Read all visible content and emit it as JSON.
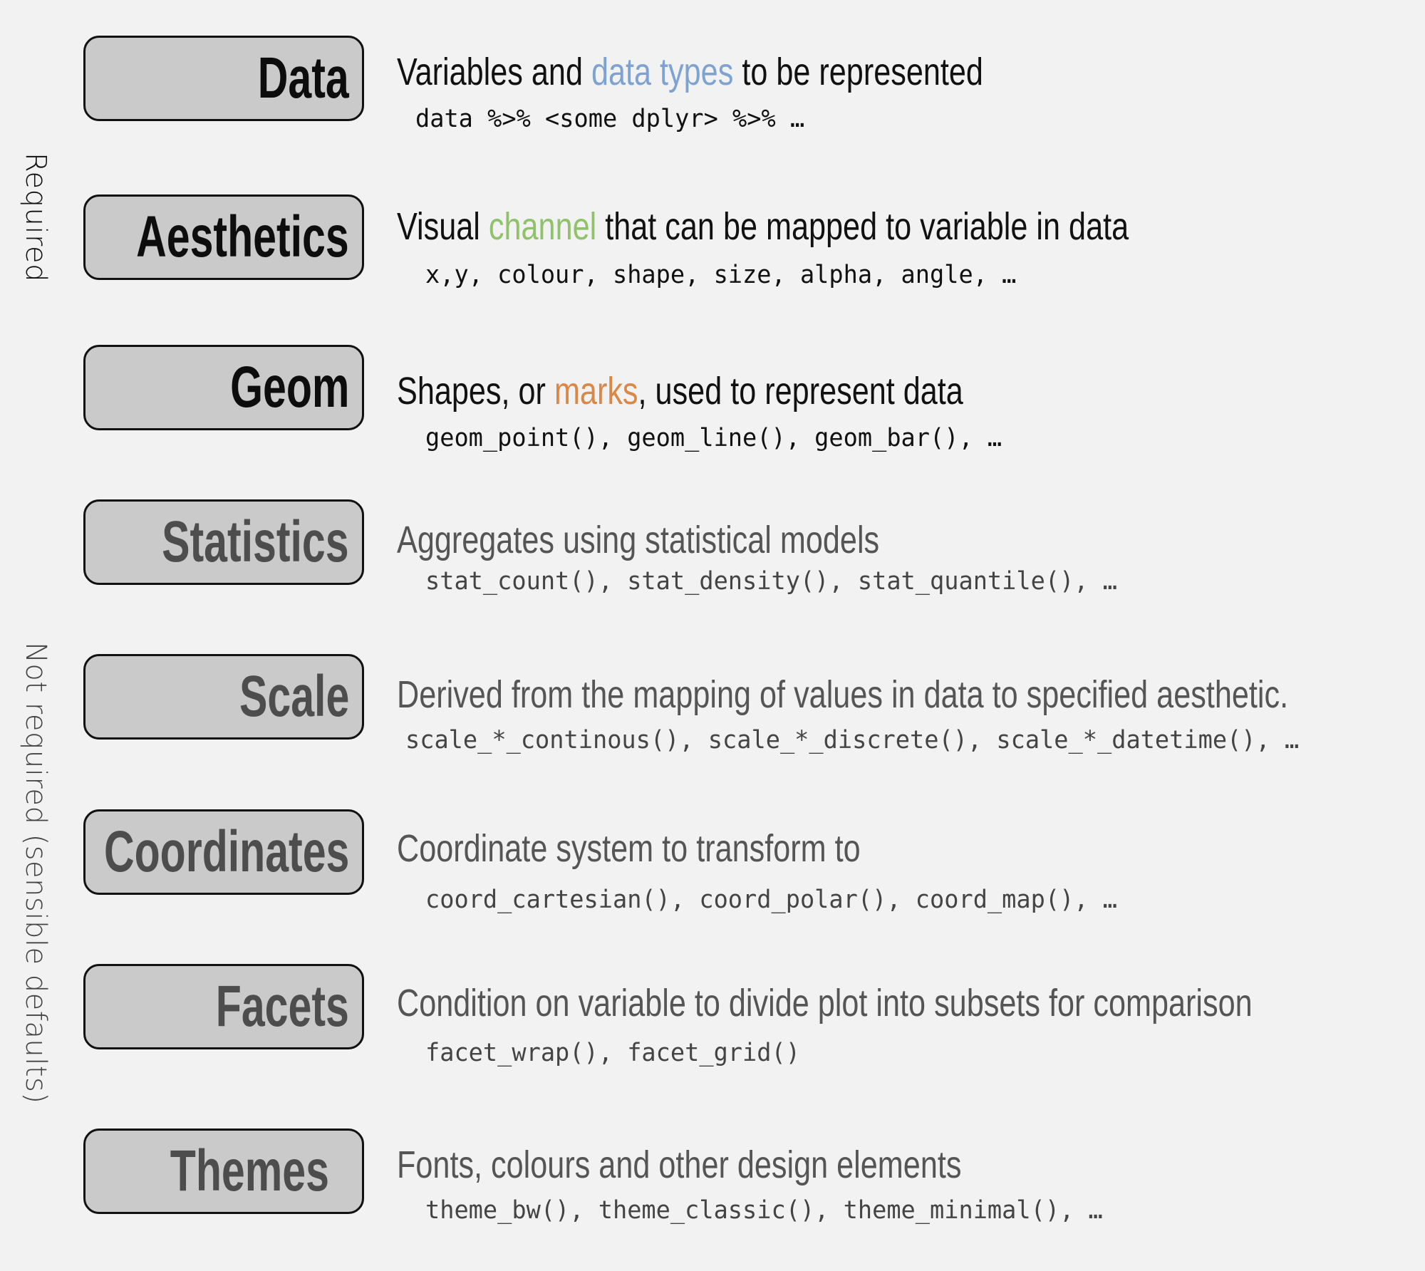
{
  "side_labels": {
    "required": "Required",
    "optional": "Not required (sensible defaults)"
  },
  "colors": {
    "background": "#f2f2f2",
    "box_fill": "#cacaca",
    "box_border": "#111111",
    "required_text": "#111111",
    "optional_text": "#4d4d4d",
    "highlight_blue": "#7fa3d1",
    "highlight_green": "#8fc26a",
    "highlight_orange": "#d8894a"
  },
  "layers": [
    {
      "label": "Data",
      "required": true,
      "desc_pre": "Variables and ",
      "desc_highlight": "data types",
      "desc_post": " to be represented",
      "code": "data %>% <some dplyr> %>% …"
    },
    {
      "label": "Aesthetics",
      "required": true,
      "desc_pre": "Visual ",
      "desc_highlight": "channel",
      "desc_post": " that can be mapped to variable in data",
      "code": "x,y, colour, shape, size, alpha, angle, …"
    },
    {
      "label": "Geom",
      "required": true,
      "desc_pre": "Shapes, or ",
      "desc_highlight": "marks",
      "desc_post": ", used to represent data",
      "code": "geom_point(), geom_line(), geom_bar(), …"
    },
    {
      "label": "Statistics",
      "required": false,
      "desc": "Aggregates using statistical models",
      "code": "stat_count(), stat_density(), stat_quantile(), …"
    },
    {
      "label": "Scale",
      "required": false,
      "desc": "Derived from the mapping of values in data to specified aesthetic.",
      "code": "scale_*_continous(), scale_*_discrete(), scale_*_datetime(), …"
    },
    {
      "label": "Coordinates",
      "required": false,
      "desc": "Coordinate system to transform to",
      "code": "coord_cartesian(), coord_polar(), coord_map(), …"
    },
    {
      "label": "Facets",
      "required": false,
      "desc": "Condition on variable to divide plot into subsets for comparison",
      "code": "facet_wrap(), facet_grid()"
    },
    {
      "label": "Themes",
      "required": false,
      "desc": "Fonts, colours and other design elements",
      "code": "theme_bw(), theme_classic(), theme_minimal(), …"
    }
  ]
}
